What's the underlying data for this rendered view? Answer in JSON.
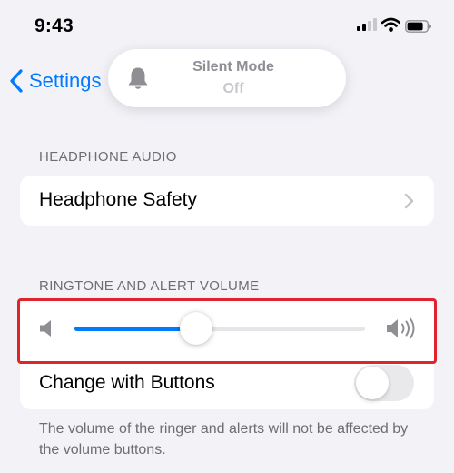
{
  "status_bar": {
    "time": "9:43",
    "icons": [
      "cellular-signal-icon",
      "wifi-icon",
      "battery-icon"
    ]
  },
  "nav": {
    "back_label": "Settings",
    "back_icon": "chevron-left-icon"
  },
  "silent_mode_hud": {
    "title": "Silent Mode",
    "state": "Off",
    "icon": "bell-icon"
  },
  "sections": {
    "headphone_audio": {
      "header": "HEADPHONE AUDIO",
      "row_label": "Headphone Safety",
      "row_icon": "chevron-right-icon"
    },
    "ringtone": {
      "header": "RINGTONE AND ALERT VOLUME",
      "volume_fraction": 0.42,
      "low_icon": "speaker-low-icon",
      "high_icon": "speaker-high-icon",
      "change_with_buttons_label": "Change with Buttons",
      "change_with_buttons_on": false,
      "footer": "The volume of the ringer and alerts will not be affected by the volume buttons."
    }
  },
  "colors": {
    "accent": "#007aff",
    "background": "#f2f2f7",
    "highlight": "#e0242e",
    "secondary_text": "#6d6d72"
  }
}
